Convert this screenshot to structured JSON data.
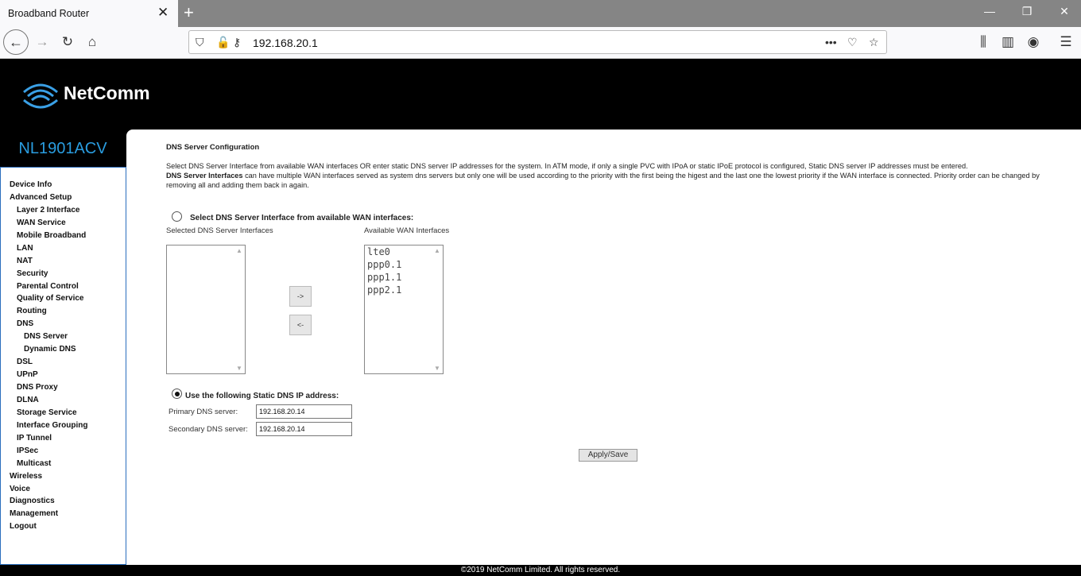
{
  "browser": {
    "tab_title": "Broadband Router",
    "url": "192.168.20.1",
    "icons": [
      "back-icon",
      "forward-icon",
      "reload-icon",
      "home-icon",
      "shield-icon",
      "insecure-lock-icon",
      "key-icon",
      "more-icon",
      "pocket-icon",
      "bookmark-star-icon",
      "library-icon",
      "sidebar-icon",
      "account-icon",
      "menu-icon"
    ]
  },
  "router": {
    "brand": "NetComm",
    "model": "NL1901ACV",
    "footer": "©2019 NetComm Limited. All rights reserved.",
    "colors": {
      "model_text": "#2a9de0",
      "sidebar_border": "#2a6ebd"
    }
  },
  "sidebar": [
    {
      "label": "Device Info",
      "level": 1
    },
    {
      "label": "Advanced Setup",
      "level": 1
    },
    {
      "label": "Layer 2 Interface",
      "level": 2
    },
    {
      "label": "WAN Service",
      "level": 2
    },
    {
      "label": "Mobile Broadband",
      "level": 2
    },
    {
      "label": "LAN",
      "level": 2
    },
    {
      "label": "NAT",
      "level": 2
    },
    {
      "label": "Security",
      "level": 2
    },
    {
      "label": "Parental Control",
      "level": 2
    },
    {
      "label": "Quality of Service",
      "level": 2
    },
    {
      "label": "Routing",
      "level": 2
    },
    {
      "label": "DNS",
      "level": 2
    },
    {
      "label": "DNS Server",
      "level": 3
    },
    {
      "label": "Dynamic DNS",
      "level": 3
    },
    {
      "label": "DSL",
      "level": 2
    },
    {
      "label": "UPnP",
      "level": 2
    },
    {
      "label": "DNS Proxy",
      "level": 2
    },
    {
      "label": "DLNA",
      "level": 2
    },
    {
      "label": "Storage Service",
      "level": 2
    },
    {
      "label": "Interface Grouping",
      "level": 2
    },
    {
      "label": "IP Tunnel",
      "level": 2
    },
    {
      "label": "IPSec",
      "level": 2
    },
    {
      "label": "Multicast",
      "level": 2
    },
    {
      "label": "Wireless",
      "level": 1
    },
    {
      "label": "Voice",
      "level": 1
    },
    {
      "label": "Diagnostics",
      "level": 1
    },
    {
      "label": "Management",
      "level": 1
    },
    {
      "label": "Logout",
      "level": 1
    }
  ],
  "main": {
    "heading": "DNS Server Configuration",
    "desc1": "Select DNS Server Interface from available WAN interfaces OR enter static DNS server IP addresses for the system. In ATM mode, if only a single PVC with IPoA or static IPoE protocol is configured, Static DNS server IP addresses must be entered.",
    "desc_bold": "DNS Server Interfaces",
    "desc2": " can have multiple WAN interfaces served as system dns servers but only one will be used according to the priority with the first being the higest and the last one the lowest priority if the WAN interface is connected. Priority order can be changed by removing all and adding them back in again.",
    "option_interface_label": "Select DNS Server Interface from available WAN interfaces:",
    "selected_label": "Selected DNS Server Interfaces",
    "available_label": "Available WAN Interfaces",
    "selected_interfaces": [],
    "available_interfaces": [
      "lte0",
      "ppp0.1",
      "ppp1.1",
      "ppp2.1"
    ],
    "add_button": "->",
    "remove_button": "<-",
    "option_static_label": "Use the following Static DNS IP address:",
    "selected_option": "static",
    "primary_label": "Primary DNS server:",
    "primary_value": "192.168.20.14",
    "secondary_label": "Secondary DNS server:",
    "secondary_value": "192.168.20.14",
    "apply_button": "Apply/Save"
  }
}
